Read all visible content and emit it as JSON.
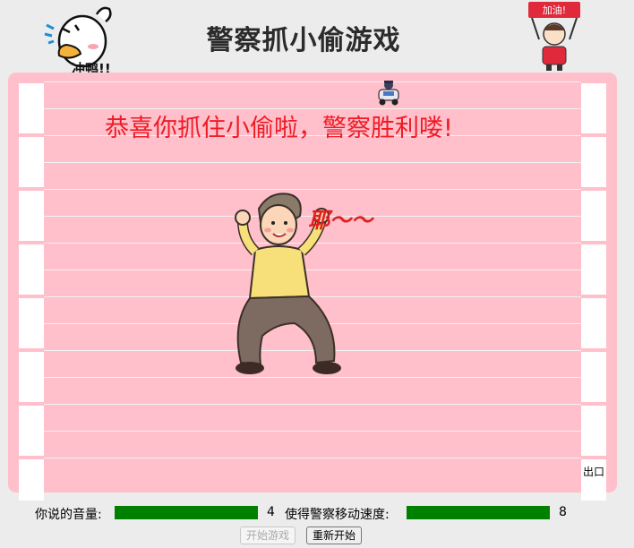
{
  "header": {
    "title": "警察抓小偷游戏",
    "left_mascot_caption": "冲鸭!!",
    "right_mascot_banner": "加油!"
  },
  "board": {
    "win_message": "恭喜你抓住小偷啦，警察胜利喽!",
    "cheer_text": "耶～～",
    "exit_label": "出口",
    "background_color": "#ffbfcb"
  },
  "controls": {
    "volume_label": "你说的音量:",
    "volume_value": "4",
    "speed_label": "使得警察移动速度:",
    "speed_value": "8",
    "bar_color": "#008000"
  },
  "buttons": {
    "start_label": "开始游戏",
    "restart_label": "重新开始"
  }
}
